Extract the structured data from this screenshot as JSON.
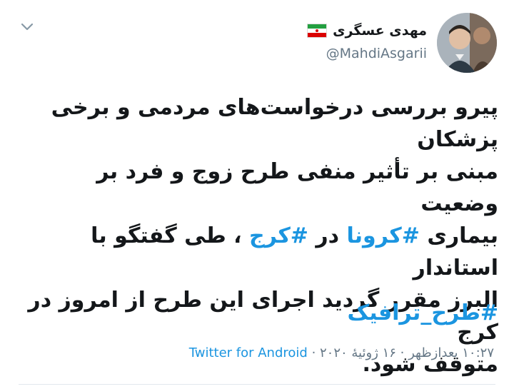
{
  "author": {
    "name": "مهدی عسگری",
    "handle": "@MahdiAsgarii",
    "flag_icon": "iran-flag-icon"
  },
  "tweet": {
    "line1": "پیرو بررسی درخواست‌های مردمی و برخی پزشکان",
    "line2": "مبنی بر تأثیر منفی طرح زوج و فرد بر وضعیت",
    "line3_before": "بیماری ",
    "hashtag_corona": "#کرونا",
    "line3_mid": " در ",
    "hashtag_karaj": "#کرج",
    "line3_after": " ، طی گفتگو با استاندار",
    "line4": "البرز مقرر گردید اجرای این طرح از امروز در کرج",
    "line5": "متوقف شود.",
    "hashtag_traffic": "#طرح_ترافیک"
  },
  "meta": {
    "time": "۱۰:۲۷ بعدازظهر",
    "date": "۱۶ ژوئیهٔ ۲۰۲۰",
    "separator": " · ",
    "source": "Twitter for Android"
  },
  "colors": {
    "link": "#1b95e0",
    "muted": "#657786",
    "text": "#14171a"
  }
}
